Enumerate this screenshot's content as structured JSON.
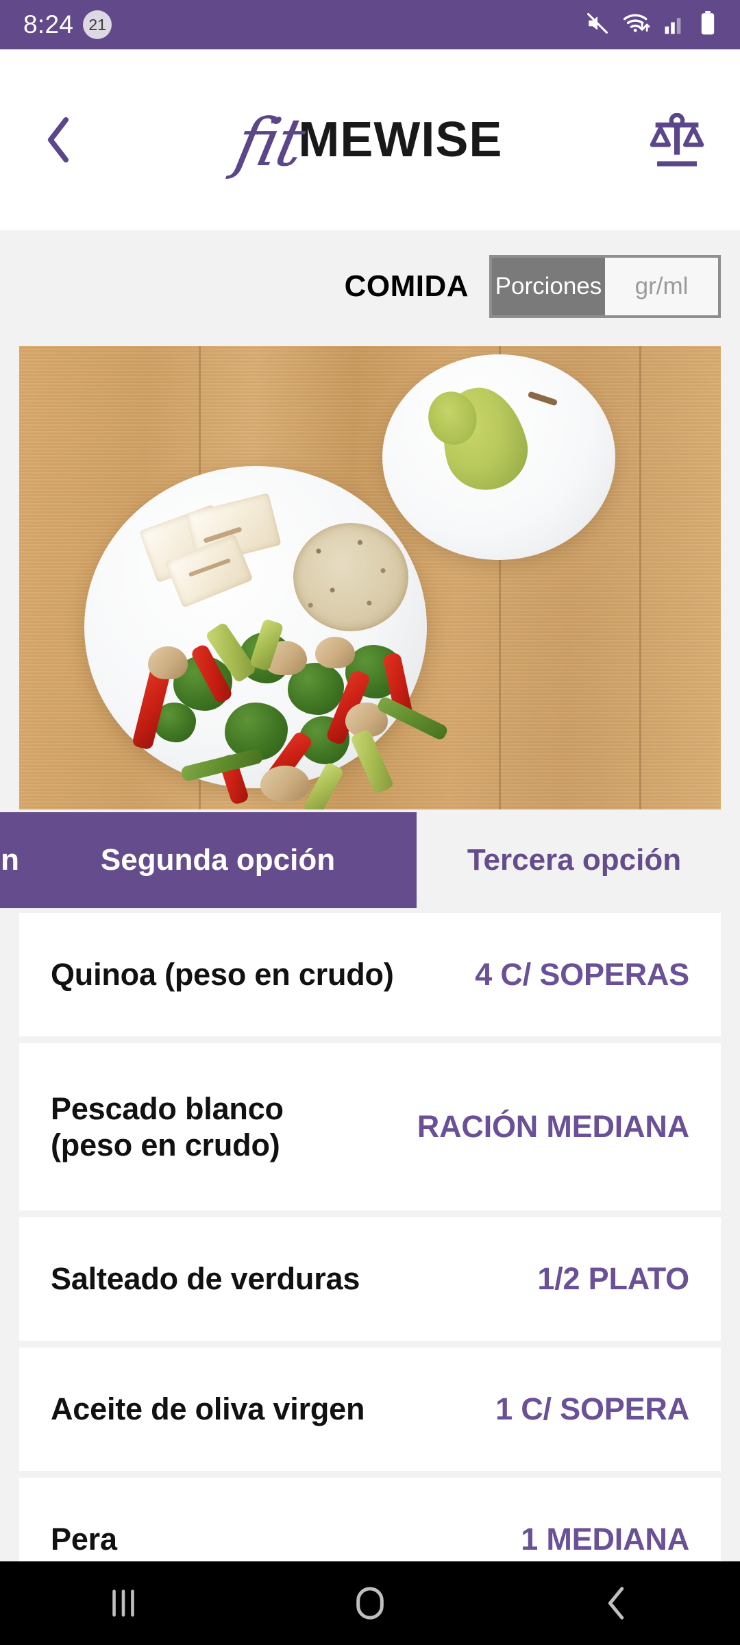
{
  "status_bar": {
    "time": "8:24",
    "notification_count": "21",
    "icons": [
      "mute-icon",
      "wifi-icon",
      "signal-icon",
      "battery-icon"
    ],
    "background_color": "#624A8A"
  },
  "header": {
    "back_label": "‹",
    "logo_script": "fit",
    "logo_bold": "MEWISE",
    "scale_icon_name": "balance-scale-icon",
    "accent_color": "#5B4689"
  },
  "meal": {
    "title": "COMIDA",
    "unit_toggle": {
      "options": [
        "Porciones",
        "gr/ml"
      ],
      "selected": "Porciones"
    }
  },
  "tabs": [
    {
      "label": "ón",
      "full_label": "Primera opción",
      "active": true,
      "clipped": true
    },
    {
      "label": "Segunda opción",
      "active": true,
      "clipped": false
    },
    {
      "label": "Tercera opción",
      "active": false,
      "clipped": false
    }
  ],
  "food_items": [
    {
      "name": "Quinoa (peso en crudo)",
      "quantity": "4 C/ SOPERAS",
      "lines": 1
    },
    {
      "name": "Pescado blanco\n(peso en crudo)",
      "quantity": "RACIÓN MEDIANA",
      "lines": 2
    },
    {
      "name": "Salteado de verduras",
      "quantity": "1/2 PLATO",
      "lines": 1
    },
    {
      "name": "Aceite de oliva virgen",
      "quantity": "1 C/ SOPERA",
      "lines": 1
    },
    {
      "name": "Pera",
      "quantity": "1 MEDIANA",
      "lines": 1
    }
  ],
  "photo": {
    "description": "Vista cenital de un plato blanco con pescado blanco a la plancha, una torta de quinoa y salteado de verduras, junto a un plato pequeño con una pera verde sobre una mesa de madera"
  },
  "android_nav": {
    "recents_label": "|||",
    "home_label": "home-icon",
    "back_label": "‹"
  },
  "colors": {
    "purple_primary": "#654C8C",
    "purple_status": "#624A8A",
    "purple_text": "#6A5096",
    "page_bg": "#F2F2F2",
    "card_bg": "#FFFFFF",
    "toggle_active_bg": "#7A7A7A"
  }
}
